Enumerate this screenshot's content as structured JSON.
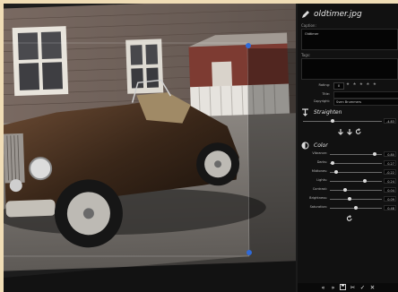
{
  "panel": {
    "file_name": "oldtimer.jpg",
    "caption_label": "Caption:",
    "caption_value": "Oldtimer",
    "tags_label": "Tags:",
    "rating_label": "Rating:",
    "rating_value": "0",
    "stars": "★ ★ ★ ★ ★",
    "title_label": "Title:",
    "title_value": "",
    "copyright_label": "Copyright:",
    "copyright_value": "Sven Brummers"
  },
  "straighten": {
    "title": "Straighten",
    "value": "-4.83",
    "level": 0.38
  },
  "color": {
    "title": "Color",
    "sliders": [
      {
        "label": "Vibrance:",
        "value": "0.80",
        "level": 0.86
      },
      {
        "label": "Darks:",
        "value": "0.27",
        "level": 0.05
      },
      {
        "label": "Midtones:",
        "value": "-0.22",
        "level": 0.12
      },
      {
        "label": "Lights:",
        "value": "0.24",
        "level": 0.68
      },
      {
        "label": "Contrast:",
        "value": "0.04",
        "level": 0.3
      },
      {
        "label": "Brightness:",
        "value": "0.09",
        "level": 0.38
      },
      {
        "label": "Saturation:",
        "value": "0.48",
        "level": 0.5
      }
    ]
  },
  "toolbar": {
    "prev": "«",
    "next": "»",
    "save": "💾",
    "tools": "✂",
    "confirm": "✓",
    "close": "✕"
  },
  "colors": {
    "accent": "#2f6ad8",
    "panel_bg": "#111111",
    "frame": "#f0ddb6"
  }
}
